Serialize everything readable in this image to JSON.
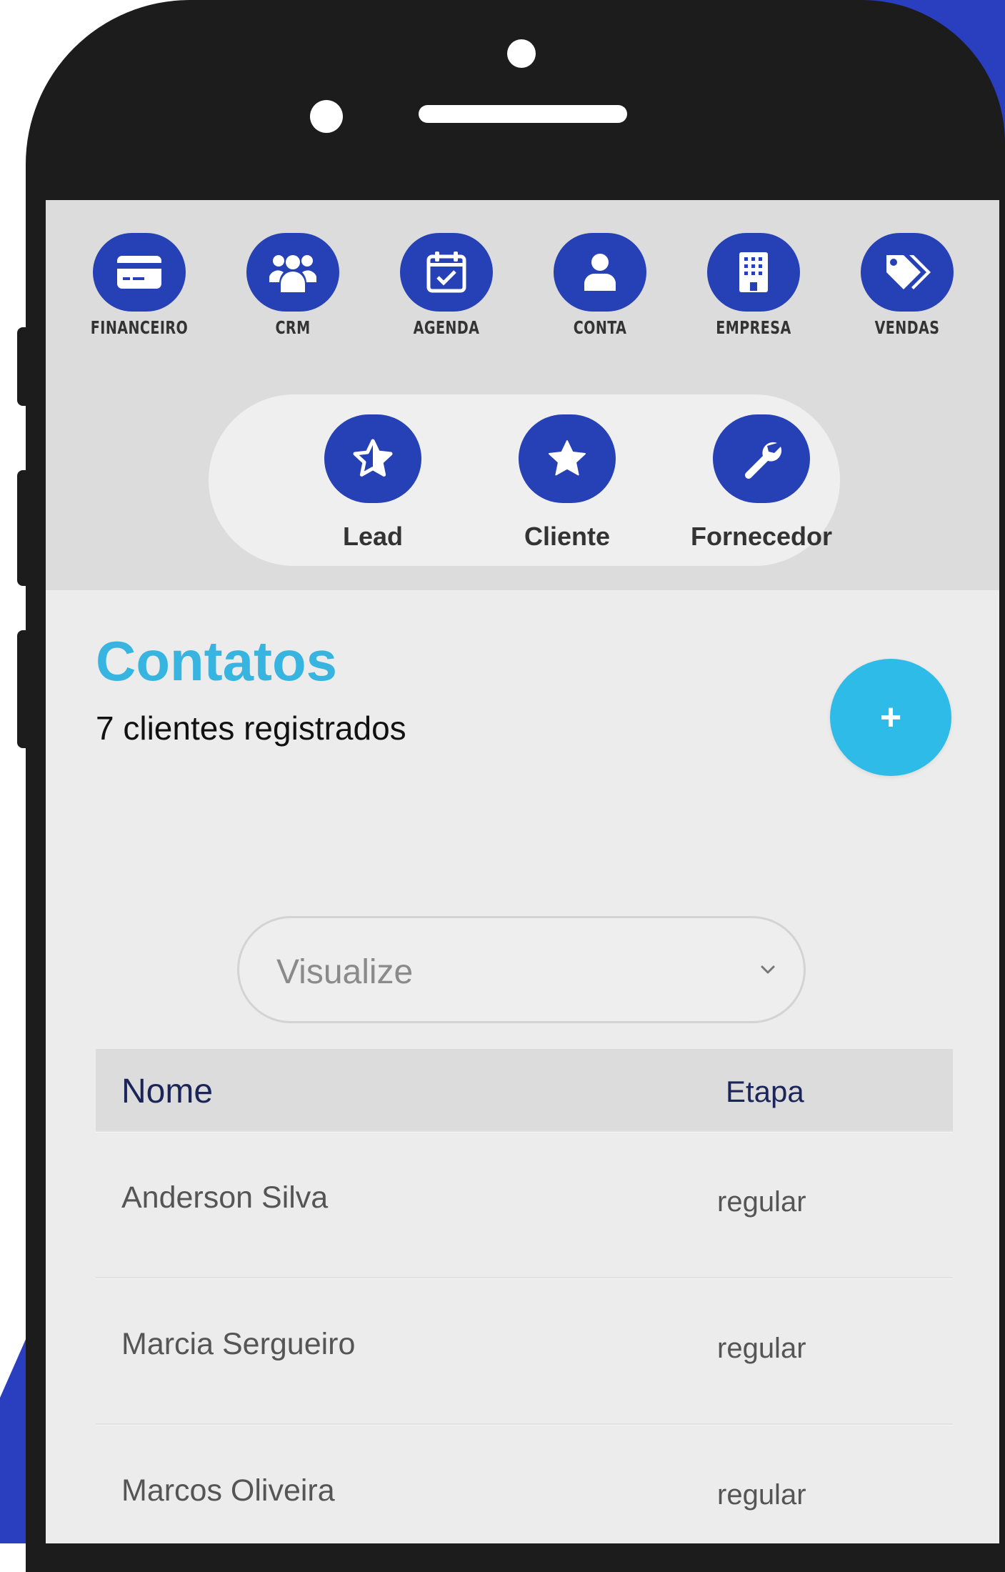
{
  "colors": {
    "brand_blue": "#2641b6",
    "accent_cyan": "#37b4e0",
    "fab": "#2fbbe8"
  },
  "modules": [
    {
      "label": "FINANCEIRO",
      "icon": "credit-card-icon"
    },
    {
      "label": "CRM",
      "icon": "users-group-icon"
    },
    {
      "label": "AGENDA",
      "icon": "calendar-check-icon"
    },
    {
      "label": "CONTA",
      "icon": "user-icon"
    },
    {
      "label": "EMPRESA",
      "icon": "building-icon"
    },
    {
      "label": "VENDAS",
      "icon": "tags-icon"
    }
  ],
  "contact_types": [
    {
      "label": "Lead",
      "icon": "star-outline-icon"
    },
    {
      "label": "Cliente",
      "icon": "star-icon"
    },
    {
      "label": "Fornecedor",
      "icon": "wrench-icon"
    }
  ],
  "page": {
    "title": "Contatos",
    "subtitle": "7 clientes registrados",
    "add_button": "+"
  },
  "filter": {
    "placeholder": "Visualize"
  },
  "table": {
    "headers": {
      "name": "Nome",
      "stage": "Etapa"
    },
    "rows": [
      {
        "name": "Anderson Silva",
        "stage": "regular"
      },
      {
        "name": "Marcia Sergueiro",
        "stage": "regular"
      },
      {
        "name": "Marcos Oliveira",
        "stage": "regular"
      }
    ]
  }
}
